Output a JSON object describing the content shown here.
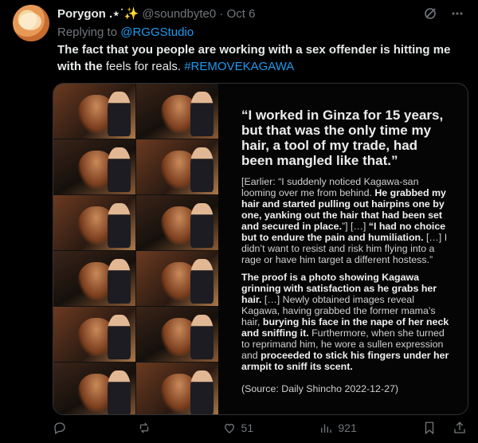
{
  "post": {
    "display_name": "Porygon",
    "name_emoji": ".⋆˙✨",
    "handle": "@soundbyte0",
    "separator": "·",
    "time": "Oct 6",
    "reply_prefix": "Replying to ",
    "reply_to": "@RGGStudio",
    "text_bold": "The fact that you people are working with a sex offender is hitting me with the",
    "text_rest": " feels for reals. ",
    "hashtag": "#REMOVEKAGAWA"
  },
  "image_text": {
    "headline": "“I worked in Ginza for 15 years, but that was the only time my hair, a tool of my trade, had been mangled like that.”",
    "p1_a": "[Earlier: “I suddenly noticed Kagawa-san looming over me from behind. ",
    "p1_b": "He grabbed my hair and started pulling out hairpins one by one, yanking out the hair that had been set and secured in place.",
    "p1_c": "”] […] ",
    "p1_d": "“I had no choice but to endure the pain and humiliation.",
    "p1_e": " […] I didn’t want to resist and risk him flying into a rage or have him target a different hostess.”",
    "p2_a": "The proof is a photo showing Kagawa grinning with satisfaction as he grabs her hair.",
    "p2_b": " […] Newly obtained images reveal Kagawa, having grabbed the former mama’s hair, ",
    "p2_c": "burying his face in the nape of her neck and sniffing it.",
    "p2_d": " Furthermore, when she turned to reprimand him, he wore a sullen expression and ",
    "p2_e": "proceeded to stick his fingers under her armpit to sniff its scent.",
    "source": "(Source: Daily Shincho 2022-12-27)"
  },
  "actions": {
    "reply_count": "",
    "retweet_count": "",
    "like_count": "51",
    "views_count": "921"
  },
  "icons": [
    "grok-icon",
    "more-icon",
    "reply-icon",
    "retweet-icon",
    "like-icon",
    "views-icon",
    "bookmark-icon",
    "share-icon"
  ],
  "colors": {
    "accent": "#1d9bf0",
    "muted": "#71767b",
    "text": "#e7e9ea"
  }
}
